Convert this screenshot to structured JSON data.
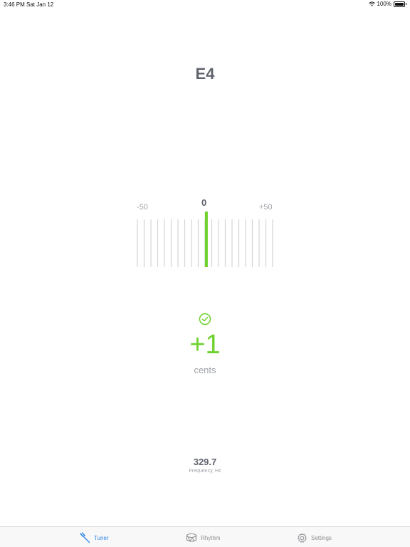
{
  "status_bar": {
    "time": "3:46 PM",
    "date": "Sat Jan 12",
    "battery": "100%"
  },
  "note": "E4",
  "meter": {
    "min_label": "-50",
    "zero_label": "0",
    "max_label": "+50",
    "range": [
      -50,
      50
    ],
    "tick_step": 5,
    "needle_value": 1
  },
  "cents": {
    "value": "+1",
    "unit": "cents",
    "in_tune_icon": "check-circle-icon"
  },
  "frequency": {
    "value": "329.7",
    "label": "Frequency, Hz"
  },
  "tab_bar": {
    "tabs": [
      {
        "label": "Tuner",
        "icon": "tuning-fork-icon",
        "active": true
      },
      {
        "label": "Rhythm",
        "icon": "drum-icon",
        "active": false
      },
      {
        "label": "Settings",
        "icon": "gear-icon",
        "active": false
      }
    ]
  },
  "colors": {
    "accent_green": "#6fd12e",
    "tab_active": "#2f87e8",
    "text_dark": "#5f636b",
    "text_gray": "#9ea1a6"
  }
}
